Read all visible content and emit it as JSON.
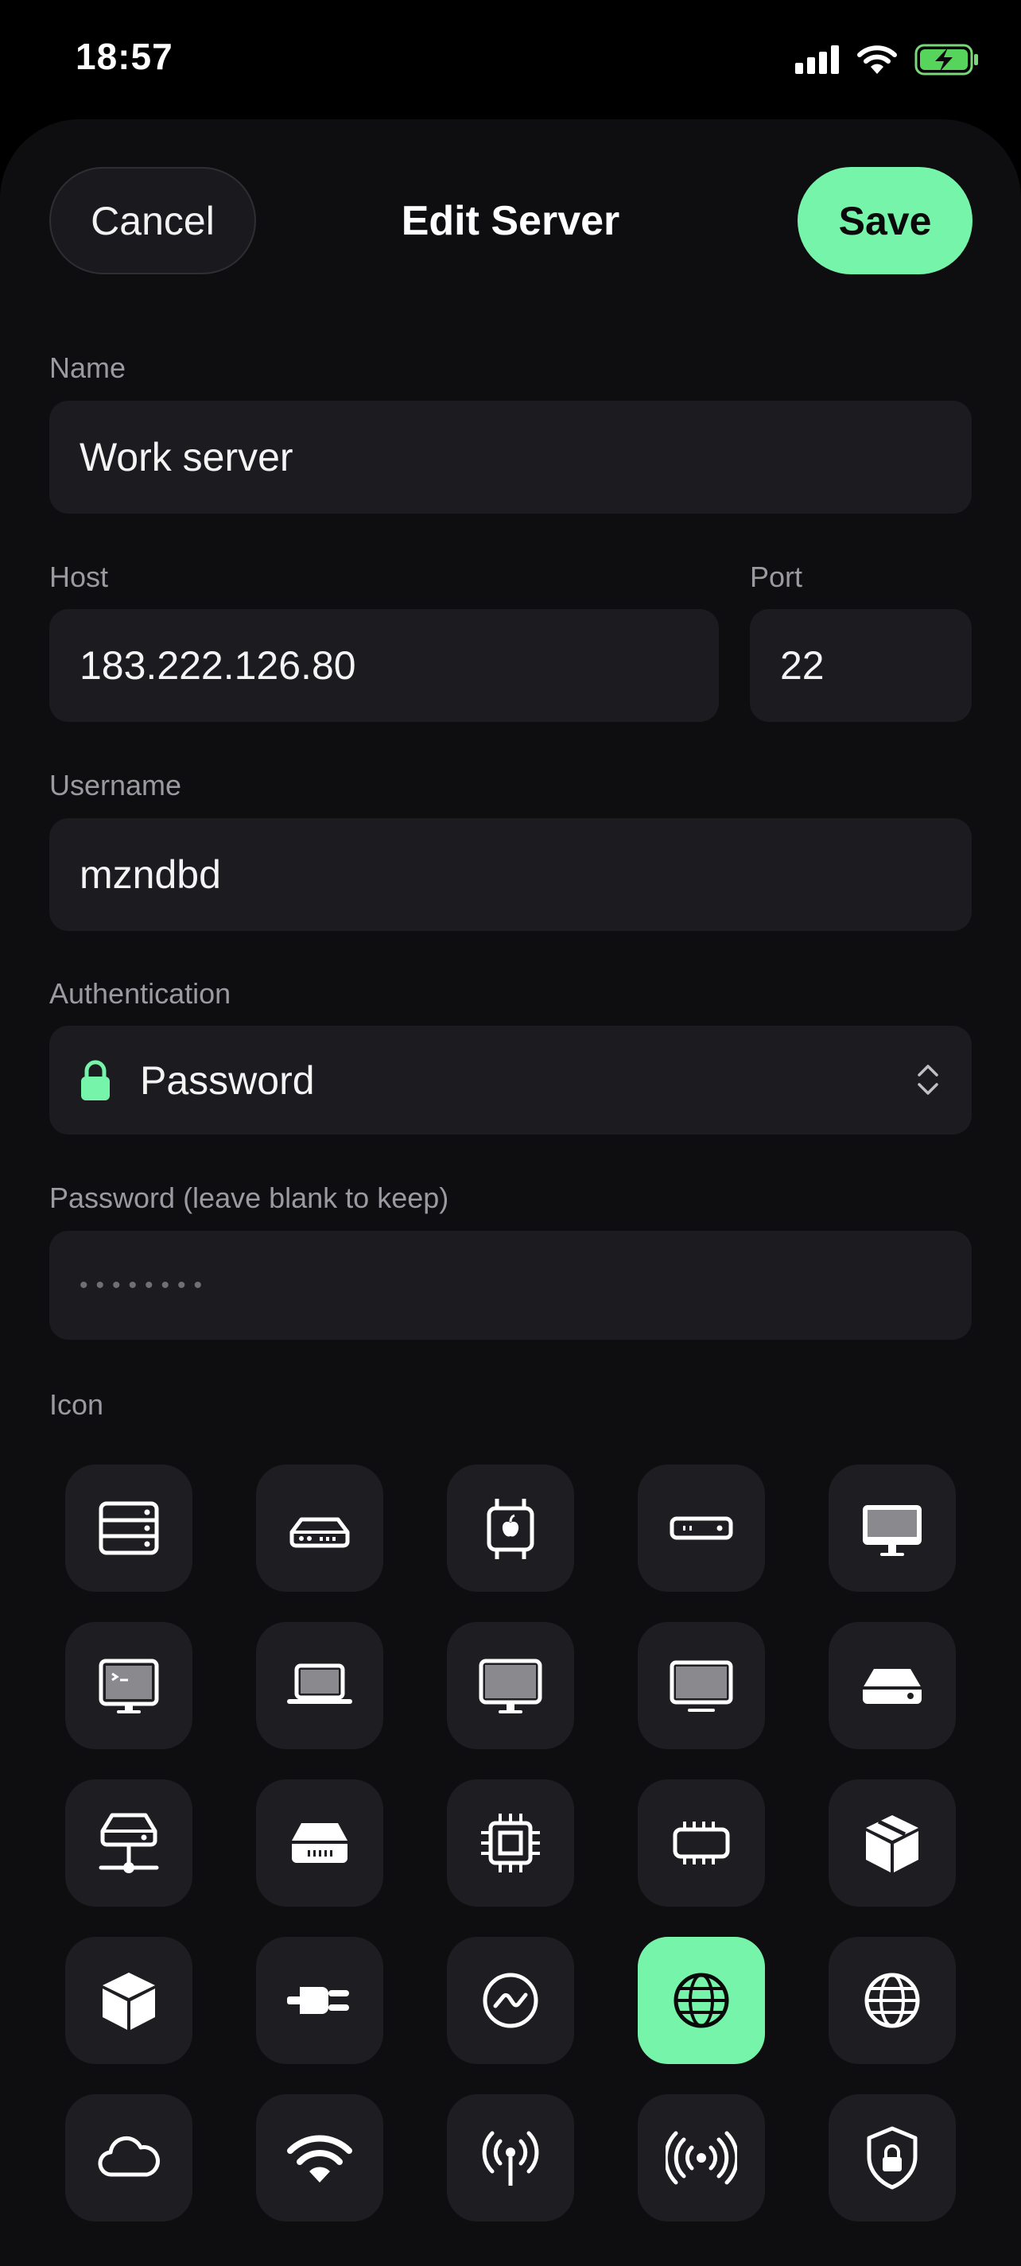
{
  "status_bar": {
    "time": "18:57"
  },
  "header": {
    "cancel_label": "Cancel",
    "title": "Edit Server",
    "save_label": "Save"
  },
  "form": {
    "name": {
      "label": "Name",
      "value": "Work server"
    },
    "host": {
      "label": "Host",
      "value": "183.222.126.80"
    },
    "port": {
      "label": "Port",
      "value": "22"
    },
    "username": {
      "label": "Username",
      "value": "mzndbd"
    },
    "authentication": {
      "label": "Authentication",
      "value": "Password"
    },
    "password": {
      "label": "Password (leave blank to keep)",
      "placeholder": "••••••••"
    },
    "icon": {
      "label": "Icon"
    }
  },
  "icons": [
    "server-rack-icon",
    "router-icon",
    "apple-chip-icon",
    "rack-unit-icon",
    "imac-icon",
    "monitor-terminal-icon",
    "laptop-icon",
    "desktop-monitor-icon",
    "display-icon",
    "external-drive-icon",
    "network-drive-icon",
    "storage-drive-icon",
    "cpu-icon",
    "memory-chip-icon",
    "package-icon",
    "cube-icon",
    "power-plug-icon",
    "waveform-circle-icon",
    "globe-icon",
    "globe-outline-icon",
    "cloud-icon",
    "wifi-icon",
    "antenna-icon",
    "broadcast-icon",
    "lock-shield-icon"
  ],
  "selected_icon": "globe-icon",
  "colors": {
    "accent": "#76f5aa",
    "background": "#0e0e10",
    "field": "#1c1c20"
  }
}
